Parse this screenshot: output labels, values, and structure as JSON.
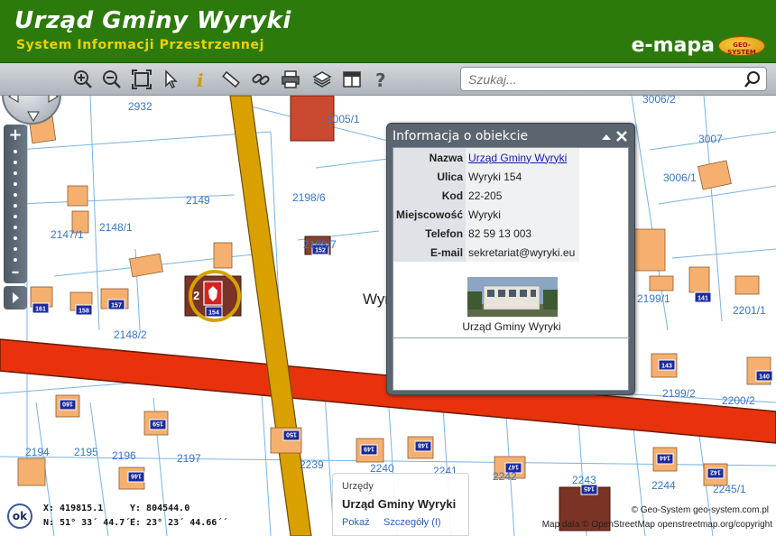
{
  "header": {
    "title": "Urząd Gminy Wyryki",
    "subtitle": "System Informacji Przestrzennej",
    "brand": "e-mapa",
    "brand_logo_text": "GEO-SYSTEM"
  },
  "toolbar": {
    "tools": [
      "zoom-in-icon",
      "zoom-out-icon",
      "zoom-extent-icon",
      "pointer-icon",
      "info-icon",
      "measure-icon",
      "link-icon",
      "print-icon",
      "layers-icon",
      "layout-icon",
      "help-icon"
    ],
    "search_placeholder": "Szukaj..."
  },
  "map": {
    "parcel_labels": [
      "2932",
      "3005/1",
      "3006/2",
      "3007",
      "2149",
      "2198/6",
      "3006/1",
      "2148/1",
      "2147/1",
      "2198/7",
      "2199/1",
      "2201/1",
      "2148/2",
      "2199/2",
      "2200/2",
      "2194",
      "2195",
      "2196",
      "2197",
      "2239",
      "2240",
      "2241",
      "2242",
      "2243",
      "2244",
      "2245/1"
    ],
    "house_numbers": [
      "161",
      "158",
      "157",
      "152",
      "154",
      "141",
      "143",
      "140",
      "160",
      "159",
      "150",
      "149",
      "148",
      "147",
      "145",
      "144",
      "142",
      "146"
    ],
    "street_label_partial": "Wyr",
    "marker_label_partial": "2"
  },
  "popup": {
    "title": "Informacja o obiekcie",
    "rows": [
      {
        "label": "Nazwa",
        "value": "Urząd Gminy Wyryki"
      },
      {
        "label": "Ulica",
        "value": "Wyryki 154"
      },
      {
        "label": "Kod",
        "value": "22-205"
      },
      {
        "label": "Miejscowość",
        "value": "Wyryki"
      },
      {
        "label": "Telefon",
        "value": "82 59 13 003"
      },
      {
        "label": "E-mail",
        "value": "sekretariat@wyryki.eu"
      }
    ],
    "photo_caption": "Urząd Gminy Wyryki"
  },
  "category": {
    "label": "Urzędy",
    "name": "Urząd Gminy Wyryki",
    "show": "Pokaż",
    "details": "Szczegóły (I)"
  },
  "coords": {
    "ok": "ok",
    "x": "X: 419815.1",
    "y": "Y: 804544.0",
    "n": "N: 51° 33´ 44.7´´",
    "e": "E: 23° 23´ 44.66´´"
  },
  "copyright": {
    "line1": "Geo-System geo-system.com.pl",
    "line1_prefix": "©",
    "line2": "Map data © OpenStreetMap openstreetmap.org/copyright"
  },
  "colors": {
    "header_bg": "#2c7a0c",
    "subtitle": "#f2d000",
    "road_main": "#e8320c",
    "road_secondary": "#d9a000",
    "building": "#f5b070",
    "building_public": "#7a3325",
    "parcel_line": "#6fb0e0",
    "label_blue": "#3a76c4"
  }
}
